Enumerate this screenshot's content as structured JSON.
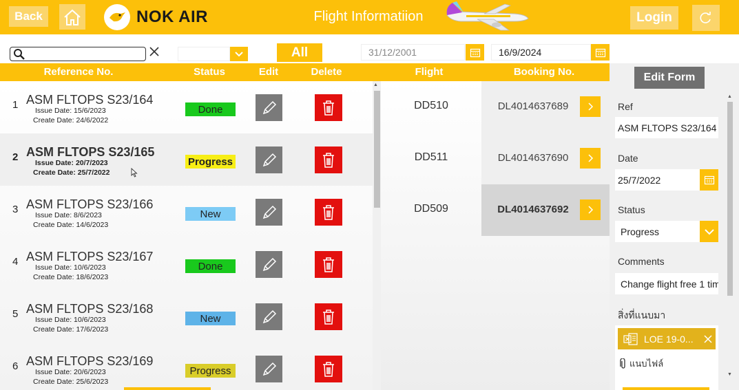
{
  "header": {
    "back_label": "Back",
    "brand": "NOK AIR",
    "title": "Flight Informatiion",
    "login_label": "Login"
  },
  "filters": {
    "search_value": "",
    "status_value": "",
    "all_label": "All",
    "date_from": "31/12/2001",
    "date_to": "16/9/2024"
  },
  "columns": {
    "reference": "Reference No.",
    "status": "Status",
    "edit": "Edit",
    "delete": "Delete",
    "flight": "Flight",
    "booking": "Booking No."
  },
  "rows": [
    {
      "num": "1",
      "ref": "ASM FLTOPS S23/164",
      "issue": "Issue Date: 15/6/2023",
      "create": "Create Date: 24/6/2022",
      "status": "Done"
    },
    {
      "num": "2",
      "ref": "ASM FLTOPS S23/165",
      "issue": "Issue Date: 20/7/2023",
      "create": "Create Date: 25/7/2022",
      "status": "Progress"
    },
    {
      "num": "3",
      "ref": "ASM FLTOPS S23/166",
      "issue": "Issue Date: 8/6/2023",
      "create": "Create Date: 14/6/2023",
      "status": "New"
    },
    {
      "num": "4",
      "ref": "ASM FLTOPS S23/167",
      "issue": "Issue Date: 10/6/2023",
      "create": "Create Date: 18/6/2023",
      "status": "Done"
    },
    {
      "num": "5",
      "ref": "ASM FLTOPS S23/168",
      "issue": "Issue Date: 10/6/2023",
      "create": "Create Date: 17/6/2023",
      "status": "New"
    },
    {
      "num": "6",
      "ref": "ASM FLTOPS S23/169",
      "issue": "Issue Date: 20/6/2023",
      "create": "Create Date: 25/6/2023",
      "status": "Progress"
    }
  ],
  "status_colors": {
    "Done": "#19c91d",
    "Progress": "#f7ee16",
    "New": "#7dcbf5",
    "New_alt": "#5eb3e8",
    "Progress_alt": "#d9cd2a"
  },
  "flights": [
    {
      "flight": "DD510",
      "booking": "DL4014637689"
    },
    {
      "flight": "DD511",
      "booking": "DL4014637690"
    },
    {
      "flight": "DD509",
      "booking": "DL4014637692"
    }
  ],
  "form": {
    "button_label": "Edit Form",
    "ref_label": "Ref",
    "ref_value": "ASM FLTOPS S23/164",
    "date_label": "Date",
    "date_value": "25/7/2022",
    "status_label": "Status",
    "status_value": "Progress",
    "comments_label": "Comments",
    "comments_value": "Change flight free 1 tim",
    "attachments_label": "สิ่งที่แนบมา",
    "attachment_name": "LOE 19-0...",
    "attach_label": "แนบไฟล์"
  },
  "accent_color": "#fcc00a"
}
